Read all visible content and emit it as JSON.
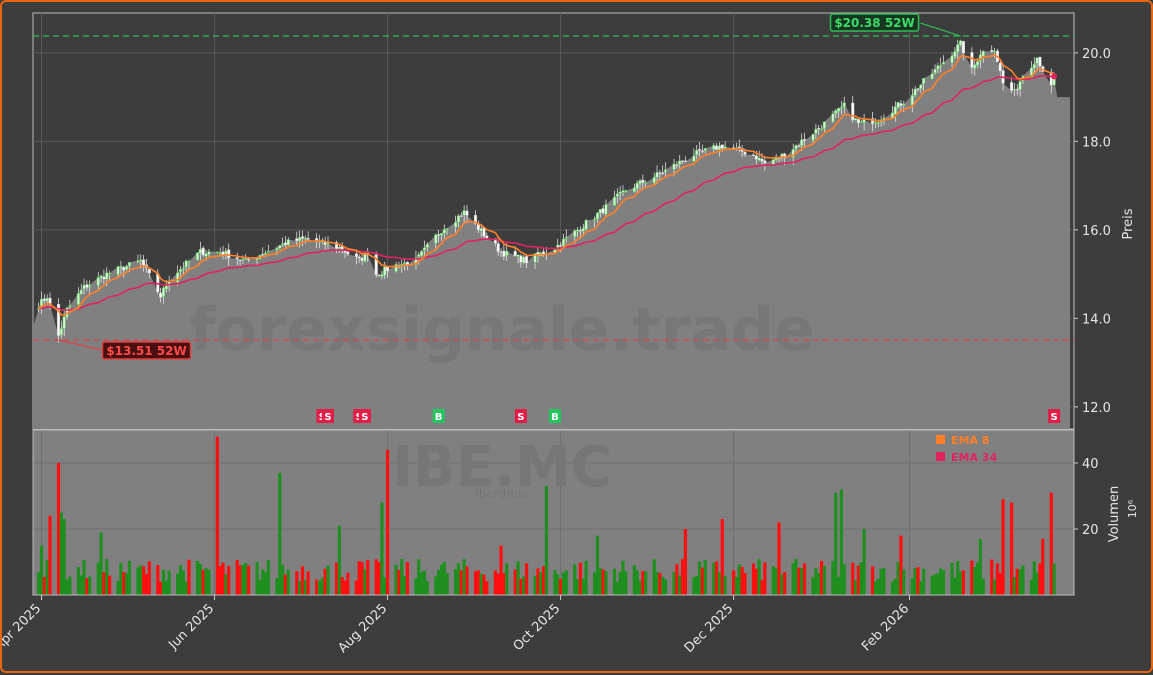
{
  "chart_data": [
    {
      "type": "candlestick",
      "title": "",
      "ylabel": "Preis",
      "ylim": [
        11.5,
        20.9
      ],
      "y_ticks": [
        "12.0",
        "14.0",
        "16.0",
        "18.0",
        "20.0"
      ],
      "x_tick_labels": [
        "Apr 2025",
        "Jun 2025",
        "Aug 2025",
        "Oct 2025",
        "Dec 2025",
        "Feb 2026"
      ],
      "x_ticks": [
        "2025-04-01",
        "2025-06-01",
        "2025-08-01",
        "2025-10-01",
        "2025-12-01",
        "2026-02-01"
      ],
      "xlim": [
        "2025-03-29",
        "2026-03-31"
      ],
      "grid": true,
      "colors": {
        "up": "#2e9e2e",
        "down": "#ff1a1a",
        "ema8": "#ff7f2a",
        "ema34": "#e0245e",
        "area": "#808080",
        "high_line": "#2ebd55",
        "low_line": "#e04040"
      },
      "close_anchors": [
        [
          "2025-03-31",
          14.3
        ],
        [
          "2025-04-03",
          14.5
        ],
        [
          "2025-04-07",
          13.6
        ],
        [
          "2025-04-10",
          14.2
        ],
        [
          "2025-04-16",
          14.7
        ],
        [
          "2025-04-24",
          15.0
        ],
        [
          "2025-05-06",
          15.3
        ],
        [
          "2025-05-13",
          14.5
        ],
        [
          "2025-05-16",
          14.9
        ],
        [
          "2025-05-27",
          15.5
        ],
        [
          "2025-06-03",
          15.5
        ],
        [
          "2025-06-12",
          15.3
        ],
        [
          "2025-06-26",
          15.7
        ],
        [
          "2025-07-03",
          15.8
        ],
        [
          "2025-07-15",
          15.6
        ],
        [
          "2025-07-22",
          15.3
        ],
        [
          "2025-07-25",
          15.5
        ],
        [
          "2025-07-28",
          15.0
        ],
        [
          "2025-08-04",
          15.2
        ],
        [
          "2025-08-11",
          15.3
        ],
        [
          "2025-08-20",
          16.0
        ],
        [
          "2025-08-28",
          16.4
        ],
        [
          "2025-09-04",
          15.9
        ],
        [
          "2025-09-10",
          15.5
        ],
        [
          "2025-09-19",
          15.3
        ],
        [
          "2025-09-29",
          15.6
        ],
        [
          "2025-10-15",
          16.4
        ],
        [
          "2025-10-24",
          16.9
        ],
        [
          "2025-11-03",
          17.2
        ],
        [
          "2025-11-17",
          17.7
        ],
        [
          "2025-11-27",
          17.9
        ],
        [
          "2025-12-08",
          17.7
        ],
        [
          "2025-12-12",
          17.5
        ],
        [
          "2025-12-19",
          17.7
        ],
        [
          "2026-01-02",
          18.4
        ],
        [
          "2026-01-09",
          18.8
        ],
        [
          "2026-01-14",
          18.4
        ],
        [
          "2026-01-21",
          18.5
        ],
        [
          "2026-01-30",
          18.9
        ],
        [
          "2026-02-10",
          19.6
        ],
        [
          "2026-02-19",
          20.2
        ],
        [
          "2026-02-23",
          19.6
        ],
        [
          "2026-02-26",
          20.0
        ],
        [
          "2026-03-03",
          20.1
        ],
        [
          "2026-03-06",
          19.3
        ],
        [
          "2026-03-10",
          19.1
        ],
        [
          "2026-03-13",
          19.5
        ],
        [
          "2026-03-18",
          19.9
        ],
        [
          "2026-03-23",
          19.2
        ],
        [
          "2026-03-24",
          19.4
        ]
      ],
      "last_close": 19.0,
      "annotations": [
        {
          "text": "$20.38 52W",
          "date": "2026-02-19",
          "value": 20.38,
          "kind": "high"
        },
        {
          "text": "$13.51 52W",
          "date": "2025-04-07",
          "value": 13.51,
          "kind": "low"
        }
      ],
      "signals": [
        {
          "date": "2025-07-09",
          "label": "S",
          "kind": "sell"
        },
        {
          "date": "2025-07-11",
          "label": "S",
          "kind": "sell"
        },
        {
          "date": "2025-07-22",
          "label": "S",
          "kind": "sell"
        },
        {
          "date": "2025-07-24",
          "label": "S",
          "kind": "sell"
        },
        {
          "date": "2025-08-19",
          "label": "B",
          "kind": "buy"
        },
        {
          "date": "2025-09-17",
          "label": "S",
          "kind": "sell"
        },
        {
          "date": "2025-09-29",
          "label": "B",
          "kind": "buy"
        },
        {
          "date": "2026-03-24",
          "label": "S",
          "kind": "sell"
        }
      ],
      "watermark": "forexsignale.trade"
    },
    {
      "type": "bar",
      "ylabel": "Volumen",
      "yunit": "10⁶",
      "ylim": [
        0,
        50
      ],
      "y_ticks": [
        "20",
        "40"
      ],
      "legend": [
        {
          "name": "EMA 8",
          "color": "#ff7f2a"
        },
        {
          "name": "EMA 34",
          "color": "#e0245e"
        }
      ],
      "legend_position": "top-right",
      "volume_spikes": [
        [
          "2025-04-01",
          15
        ],
        [
          "2025-04-04",
          24
        ],
        [
          "2025-04-07",
          40
        ],
        [
          "2025-04-08",
          25
        ],
        [
          "2025-04-09",
          23
        ],
        [
          "2025-04-22",
          19
        ],
        [
          "2025-06-02",
          48
        ],
        [
          "2025-06-24",
          37
        ],
        [
          "2025-07-15",
          21
        ],
        [
          "2025-07-30",
          28
        ],
        [
          "2025-08-01",
          44
        ],
        [
          "2025-09-10",
          15
        ],
        [
          "2025-09-26",
          33
        ],
        [
          "2025-10-14",
          18
        ],
        [
          "2025-11-14",
          20
        ],
        [
          "2025-11-27",
          23
        ],
        [
          "2025-12-17",
          22
        ],
        [
          "2026-01-06",
          31
        ],
        [
          "2026-01-08",
          32
        ],
        [
          "2026-01-16",
          20
        ],
        [
          "2026-01-29",
          18
        ],
        [
          "2026-02-26",
          17
        ],
        [
          "2026-03-06",
          29
        ],
        [
          "2026-03-09",
          28
        ],
        [
          "2026-03-20",
          17
        ],
        [
          "2026-03-23",
          31
        ]
      ],
      "watermark_symbol": "IBE.MC",
      "watermark_name": "Iberdrola"
    }
  ]
}
